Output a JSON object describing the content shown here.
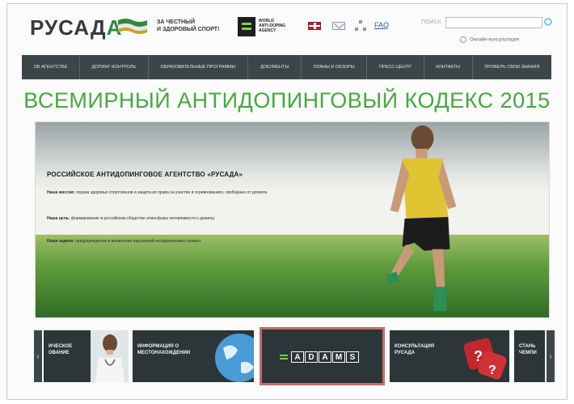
{
  "header": {
    "logo_main": "РУСАД",
    "logo_accent": "А",
    "slogan_line1": "ЗА ЧЕСТНЫЙ",
    "slogan_line2": "И ЗДОРОВЫЙ СПОРТ!",
    "wada_line1": "WORLD",
    "wada_line2": "ANTI-DOPING",
    "wada_line3": "AGENCY",
    "faq": "FAQ",
    "search_label": "ПОИСК",
    "search_placeholder": "",
    "consult": "Онлайн-консультация"
  },
  "nav": {
    "items": [
      "ОБ АГЕНТСТВЕ",
      "ДОПИНГ-КОНТРОЛЬ",
      "ОБРАЗОВАТЕЛЬНЫЕ ПРОГРАММЫ",
      "ДОКУМЕНТЫ",
      "ПЛАНЫ И ОБЗОРЫ",
      "ПРЕСС-ЦЕНТР",
      "КОНТАКТЫ",
      "ПРОВЕРЬ СВОИ ЗНАНИЯ"
    ]
  },
  "headline": "ВСЕМИРНЫЙ АНТИДОПИНГОВЫЙ КОДЕКС 2015",
  "banner": {
    "title": "РОССИЙСКОЕ АНТИДОПИНГОВОЕ АГЕНТСТВО «РУСАДА»",
    "para1_label": "Наша миссия:",
    "para1": "охрана здоровья спортсменов и защита их права на участие в соревнованиях, свободных от допинга.",
    "para2_label": "Наша цель:",
    "para2": "формирование в российском обществе атмосферы нетерпимости к допингу.",
    "para3_label": "Наши задачи:",
    "para3": "предупреждение и выявление нарушений антидопинговых правил."
  },
  "carousel": {
    "prev": "‹",
    "next": "›",
    "card1": "ИЧЕСКОЕ ОВАНИЕ",
    "card2_line1": "ИНФОРМАЦИЯ О",
    "card2_line2": "МЕСТОНАХОЖДЕНИИ",
    "card3_letters": [
      "A",
      "D",
      "A",
      "M",
      "S"
    ],
    "card4_line1": "КОНСУЛЬТАЦИЯ",
    "card4_line2": "РУСАДА",
    "card5_line1": "СТАНЬ",
    "card5_line2": "ЧЕМПИ"
  },
  "colors": {
    "nav_bg": "#3b4649",
    "headline": "#47a83f",
    "accent_green": "#7ad24a",
    "adams_border": "#c66b6b"
  }
}
